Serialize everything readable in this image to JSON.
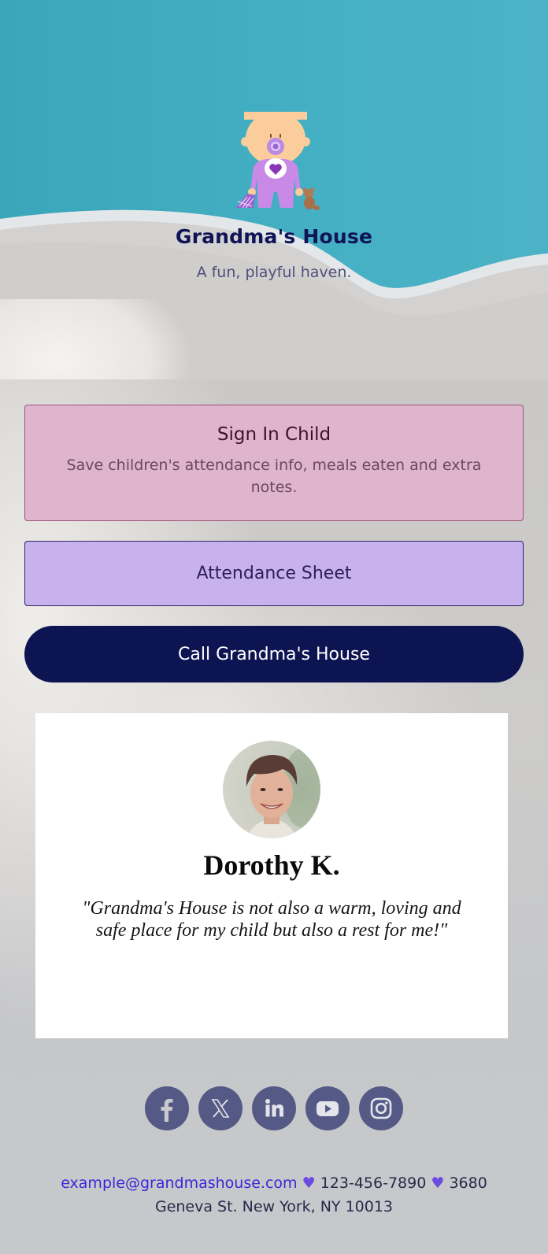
{
  "hero": {
    "logo_icon": "baby-with-pacifier-icon",
    "title": "Grandma's House",
    "tagline": "A fun, playful haven."
  },
  "buttons": {
    "sign_in": {
      "title": "Sign In Child",
      "description": "Save children's attendance info, meals eaten and extra notes."
    },
    "attendance": {
      "label": "Attendance Sheet"
    },
    "call": {
      "label": "Call Grandma's House"
    }
  },
  "testimonial": {
    "avatar_icon": "person-photo",
    "name": "Dorothy K.",
    "quote": "\"Grandma's House is not also a warm, loving and safe place for my child but also a rest for me!\""
  },
  "social": [
    {
      "name": "facebook",
      "icon": "facebook-icon"
    },
    {
      "name": "x",
      "icon": "x-icon"
    },
    {
      "name": "linkedin",
      "icon": "linkedin-icon"
    },
    {
      "name": "youtube",
      "icon": "youtube-icon"
    },
    {
      "name": "instagram",
      "icon": "instagram-icon"
    }
  ],
  "footer": {
    "email": "example@grandmashouse.com",
    "separator": "♥",
    "phone": "123-456-7890",
    "address_part1": "3680",
    "address_part2": "Geneva St. New York, NY 10013"
  },
  "colors": {
    "hero_teal": "#45b0c4",
    "title_navy": "#0f1457",
    "sign_in_pink": "#dfb4cd",
    "attendance_lavender": "#c8b2ee",
    "call_navy": "#0d1452",
    "social_slate": "#545a85",
    "email_link": "#3b27d6"
  }
}
